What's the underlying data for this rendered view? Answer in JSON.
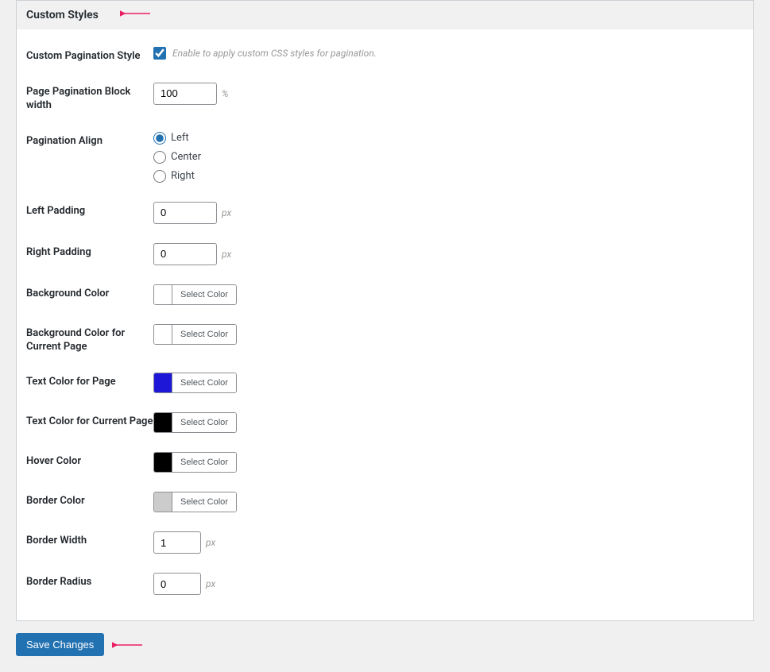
{
  "section": {
    "title": "Custom Styles"
  },
  "fields": {
    "custom_pagination_style": {
      "label": "Custom Pagination Style",
      "hint": "Enable to apply custom CSS styles for pagination.",
      "checked": true
    },
    "block_width": {
      "label": "Page Pagination Block width",
      "value": "100",
      "unit": "%"
    },
    "align": {
      "label": "Pagination Align",
      "options": {
        "left": "Left",
        "center": "Center",
        "right": "Right"
      },
      "selected": "left"
    },
    "left_padding": {
      "label": "Left Padding",
      "value": "0",
      "unit": "px"
    },
    "right_padding": {
      "label": "Right Padding",
      "value": "0",
      "unit": "px"
    },
    "bg_color": {
      "label": "Background Color",
      "swatch": "#ffffff",
      "btn": "Select Color"
    },
    "bg_color_current": {
      "label": "Background Color for Current Page",
      "swatch": "#ffffff",
      "btn": "Select Color"
    },
    "text_color_page": {
      "label": "Text Color for Page",
      "swatch": "#1e17d8",
      "btn": "Select Color"
    },
    "text_color_current": {
      "label": "Text Color for Current Page",
      "swatch": "#000000",
      "btn": "Select Color"
    },
    "hover_color": {
      "label": "Hover Color",
      "swatch": "#000000",
      "btn": "Select Color"
    },
    "border_color": {
      "label": "Border Color",
      "swatch": "#cccccc",
      "btn": "Select Color"
    },
    "border_width": {
      "label": "Border Width",
      "value": "1",
      "unit": "px"
    },
    "border_radius": {
      "label": "Border Radius",
      "value": "0",
      "unit": "px"
    }
  },
  "actions": {
    "save": "Save Changes"
  }
}
